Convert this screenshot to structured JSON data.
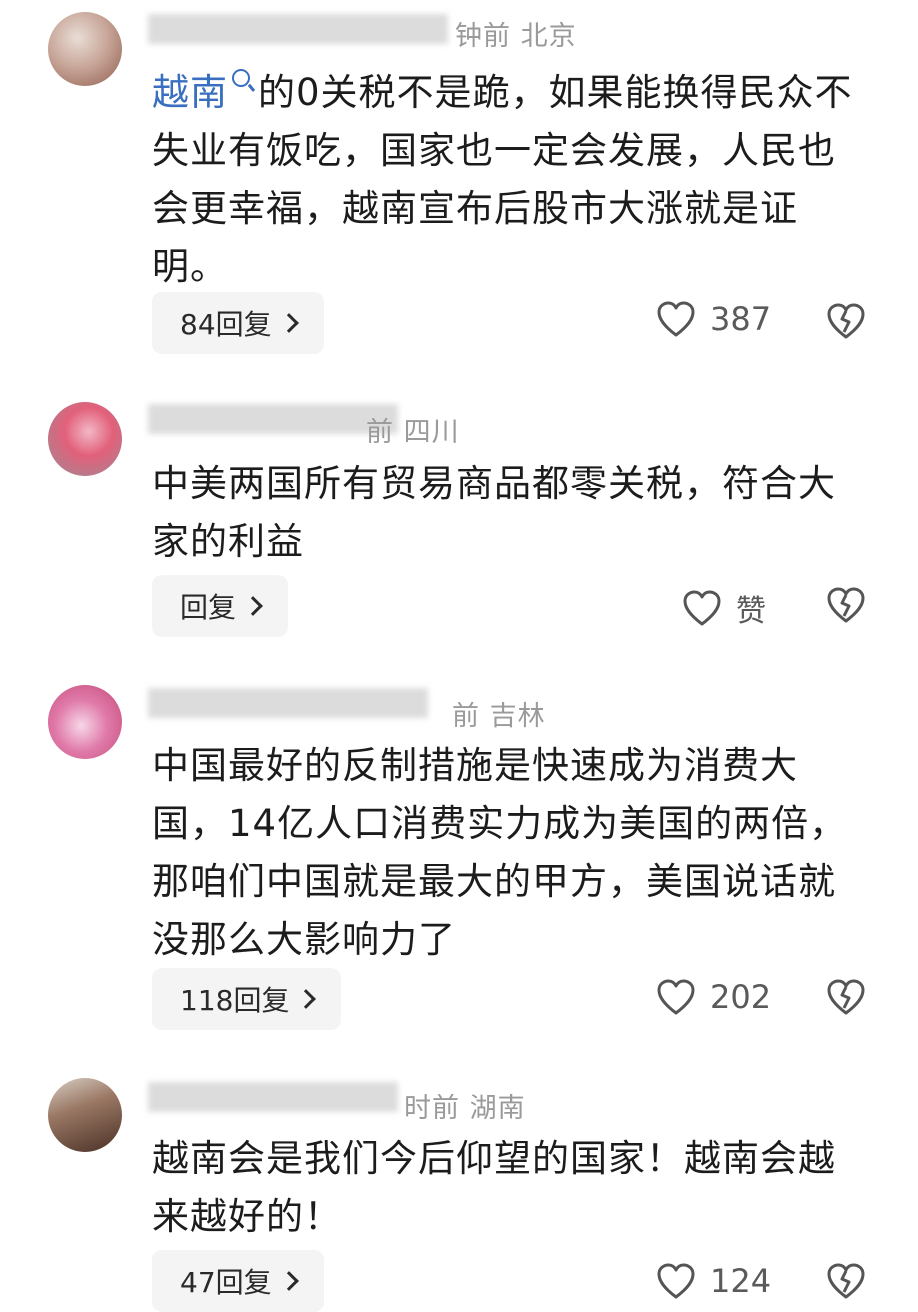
{
  "comments": [
    {
      "meta": "钟前 北京",
      "mention": "越南",
      "text_rest": "的0关税不是跪，如果能换得民众不失业有饭吃，国家也一定会发展，人民也会更幸福，越南宣布后股市大涨就是证明。",
      "reply_label": "84回复",
      "like_count": "387"
    },
    {
      "meta": "前 四川",
      "text": "中美两国所有贸易商品都零关税，符合大家的利益",
      "reply_label": "回复",
      "like_count": "赞"
    },
    {
      "meta": "前 吉林",
      "text": "中国最好的反制措施是快速成为消费大国，14亿人口消费实力成为美国的两倍，那咱们中国就是最大的甲方，美国说话就没那么大影响力了",
      "reply_label": "118回复",
      "like_count": "202"
    },
    {
      "meta": "时前 湖南",
      "text": "越南会是我们今后仰望的国家！越南会越来越好的！",
      "reply_label": "47回复",
      "like_count": "124"
    }
  ],
  "icons": {
    "like": "heart-outline-icon",
    "dislike": "broken-heart-icon",
    "chevron": "chevron-right-icon",
    "mention": "search-icon"
  },
  "colors": {
    "mention": "#3a6fc0",
    "meta": "#9a9a9a",
    "reply_bg": "#f4f4f4"
  }
}
